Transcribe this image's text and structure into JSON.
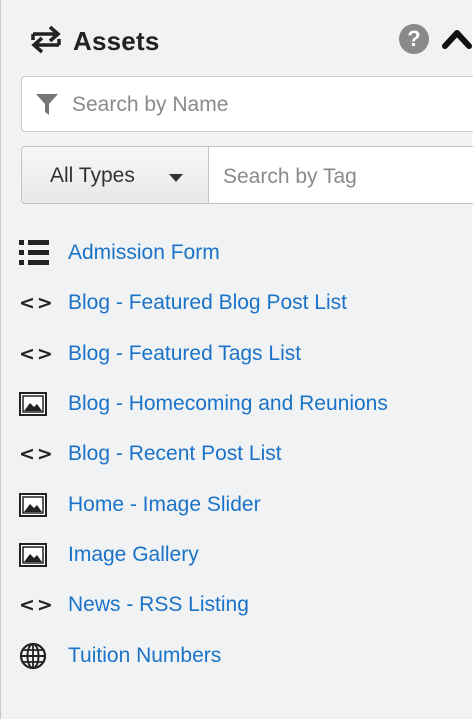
{
  "panel": {
    "title": "Assets",
    "title_icon": "swap-arrows-icon",
    "help_label": "?",
    "collapse_icon": "chevron-up-icon"
  },
  "search": {
    "name_placeholder": "Search by Name",
    "name_value": "",
    "tag_placeholder": "Search by Tag",
    "tag_value": "",
    "type_filter_label": "All Types"
  },
  "colors": {
    "link": "#1a73c8",
    "panel_bg": "#f1f2f3"
  },
  "assets": [
    {
      "name": "Admission Form",
      "icon": "list-icon"
    },
    {
      "name": "Blog - Featured Blog Post List",
      "icon": "code-icon"
    },
    {
      "name": "Blog - Featured Tags List",
      "icon": "code-icon"
    },
    {
      "name": "Blog - Homecoming and Reunions",
      "icon": "image-icon"
    },
    {
      "name": "Blog - Recent Post List",
      "icon": "code-icon"
    },
    {
      "name": "Home - Image Slider",
      "icon": "image-icon"
    },
    {
      "name": "Image Gallery",
      "icon": "image-icon"
    },
    {
      "name": "News - RSS Listing",
      "icon": "code-icon"
    },
    {
      "name": "Tuition Numbers",
      "icon": "globe-icon"
    }
  ]
}
